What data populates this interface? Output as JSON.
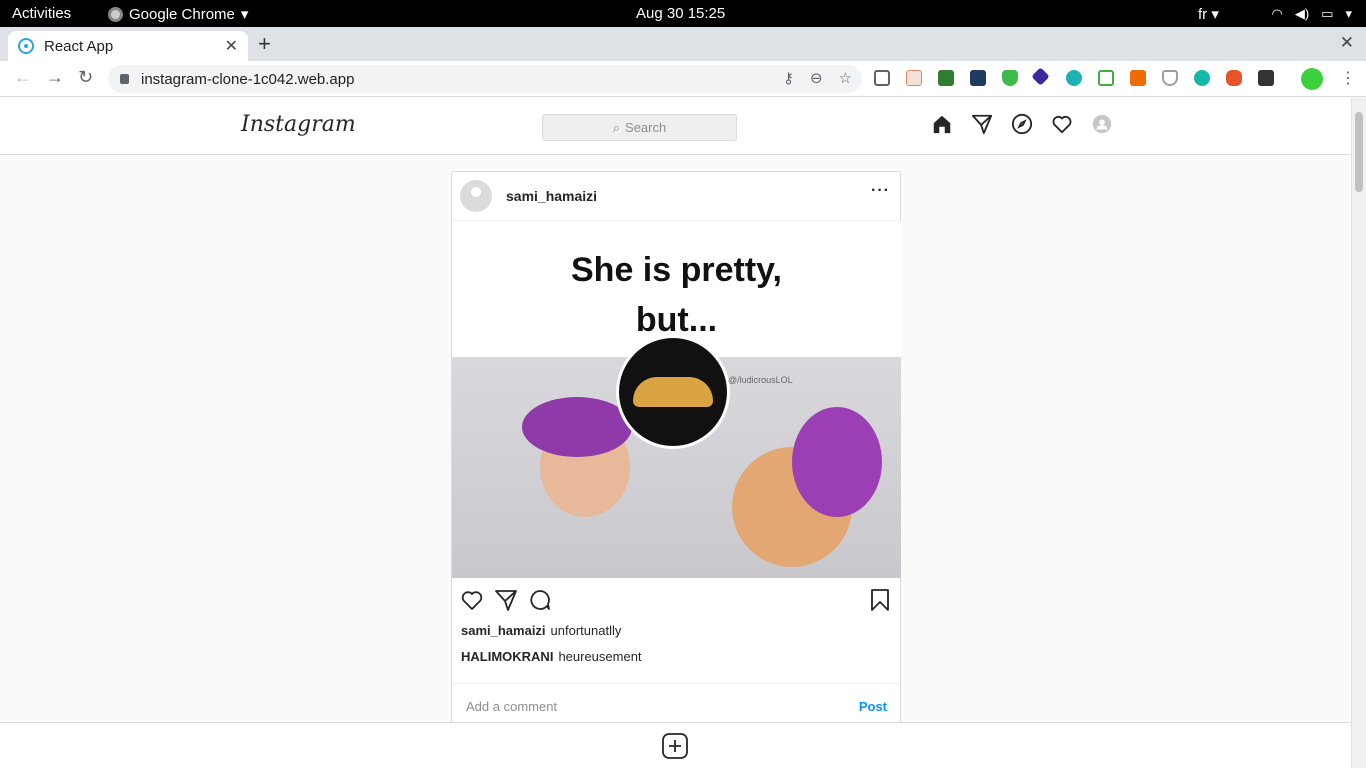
{
  "os": {
    "activities": "Activities",
    "app_name": "Google Chrome",
    "clock": "Aug 30  15:25",
    "lang": "fr"
  },
  "browser": {
    "tab_title": "React App",
    "url": "instagram-clone-1c042.web.app"
  },
  "ig": {
    "logo": "Instagram",
    "search_placeholder": "Search"
  },
  "post": {
    "username": "sami_hamaizi",
    "meme_line1": "She is pretty,",
    "meme_line2": "but...",
    "credit": "@/ludicrousLOL",
    "captions": [
      {
        "user": "sami_hamaizi",
        "text": "unfortunatlly"
      },
      {
        "user": "HALIMOKRANI",
        "text": "heureusement"
      }
    ],
    "comment_placeholder": "Add a comment",
    "post_label": "Post"
  },
  "colors": {
    "accent": "#0095f6",
    "border": "#dbdbdb"
  }
}
